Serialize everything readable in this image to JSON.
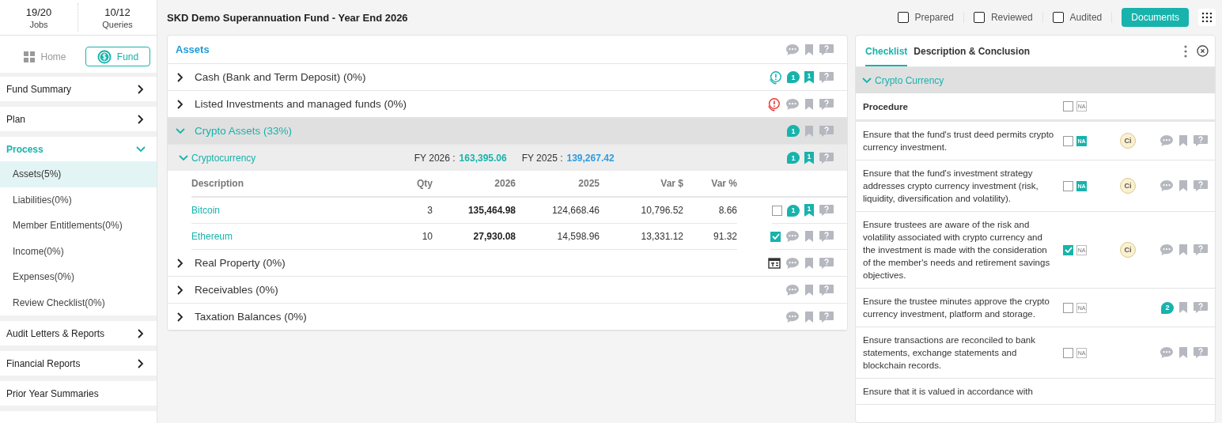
{
  "sidebar": {
    "stats": [
      {
        "value": "19/20",
        "label": "Jobs"
      },
      {
        "value": "10/12",
        "label": "Queries"
      }
    ],
    "nav": [
      {
        "kind": "home",
        "label": "Home",
        "selected": false
      },
      {
        "kind": "fund",
        "label": "Fund",
        "selected": true
      }
    ],
    "sections": [
      {
        "label": "Fund Summary",
        "expanded": false
      },
      {
        "label": "Plan",
        "expanded": false
      },
      {
        "label": "Process",
        "expanded": true,
        "children": [
          {
            "label": "Assets(5%)",
            "selected": true
          },
          {
            "label": "Liabilities(0%)",
            "selected": false
          },
          {
            "label": "Member Entitlements(0%)",
            "selected": false
          },
          {
            "label": "Income(0%)",
            "selected": false
          },
          {
            "label": "Expenses(0%)",
            "selected": false
          },
          {
            "label": "Review Checklist(0%)",
            "selected": false
          }
        ]
      },
      {
        "label": "Audit Letters & Reports",
        "expanded": false
      },
      {
        "label": "Financial Reports",
        "expanded": false
      },
      {
        "label": "Prior Year Summaries"
      }
    ]
  },
  "header": {
    "title": "SKD Demo Superannuation Fund - Year End 2026",
    "signoffs": [
      {
        "label": "Prepared",
        "checked": false
      },
      {
        "label": "Reviewed",
        "checked": false
      },
      {
        "label": "Audited",
        "checked": false
      }
    ],
    "documents_button": "Documents"
  },
  "assets": {
    "title": "Assets",
    "groups": [
      {
        "label": "Cash (Bank and Term Deposit) (0%)",
        "expanded": false,
        "selected": false,
        "kind": "info",
        "comments": "1",
        "bookmarks": "1"
      },
      {
        "label": "Listed Investments and managed funds (0%)",
        "expanded": false,
        "selected": false,
        "kind": "alert"
      },
      {
        "label": "Crypto Assets (33%)",
        "expanded": true,
        "selected": true,
        "comments": "1",
        "subgroups": [
          {
            "label": "Cryptocurrency",
            "fy_current_label": "FY 2026 :",
            "fy_current": "163,395.06",
            "fy_prior_label": "FY 2025 :",
            "fy_prior": "139,267.42",
            "comments": "1",
            "bookmarks": "1",
            "columns": [
              "Description",
              "Qty",
              "2026",
              "2025",
              "Var $",
              "Var %"
            ],
            "rows": [
              {
                "description": "Bitcoin",
                "qty": "3",
                "current": "135,464.98",
                "prior": "124,668.46",
                "var_amount": "10,796.52",
                "var_percent": "8.66",
                "checked": false,
                "comments": "1",
                "bookmarks": "1"
              },
              {
                "description": "Ethereum",
                "qty": "10",
                "current": "27,930.08",
                "prior": "14,598.96",
                "var_amount": "13,331.12",
                "var_percent": "91.32",
                "checked": true
              }
            ]
          }
        ]
      },
      {
        "label": "Real Property (0%)",
        "expanded": false,
        "selected": false,
        "kind": "calendar"
      },
      {
        "label": "Receivables (0%)",
        "expanded": false,
        "selected": false
      },
      {
        "label": "Taxation Balances (0%)",
        "expanded": false,
        "selected": false
      }
    ]
  },
  "checklist": {
    "tabs": [
      {
        "label": "Checklist",
        "selected": true
      },
      {
        "label": "Description & Conclusion",
        "selected": false
      }
    ],
    "section": {
      "label": "Crypto Currency",
      "expanded": true
    },
    "header": {
      "label": "Procedure",
      "checked": false,
      "na": false,
      "na_label": "NA"
    },
    "items": [
      {
        "text": "Ensure that the fund's trust deed permits crypto currency investment.",
        "checked": false,
        "na": true,
        "na_label": "NA",
        "badge": "Ci"
      },
      {
        "text": "Ensure that the fund's investment strategy addresses crypto currency investment (risk, liquidity, diversification and volatility).",
        "checked": false,
        "na": true,
        "na_label": "NA",
        "badge": "Ci"
      },
      {
        "text": "Ensure trustees are aware of the risk and volatility associated with crypto currency and the investment is made with the consideration of the member's needs and retirement savings objectives.",
        "checked": true,
        "na": false,
        "na_label": "NA",
        "badge": "Ci"
      },
      {
        "text": "Ensure the trustee minutes approve the crypto currency investment, platform and storage.",
        "checked": false,
        "na": false,
        "na_label": "NA",
        "comments": "2"
      },
      {
        "text": "Ensure transactions are reconciled to bank statements, exchange statements and blockchain records.",
        "checked": false,
        "na": false,
        "na_label": "NA"
      },
      {
        "text": "Ensure that it is valued in accordance with"
      }
    ]
  }
}
